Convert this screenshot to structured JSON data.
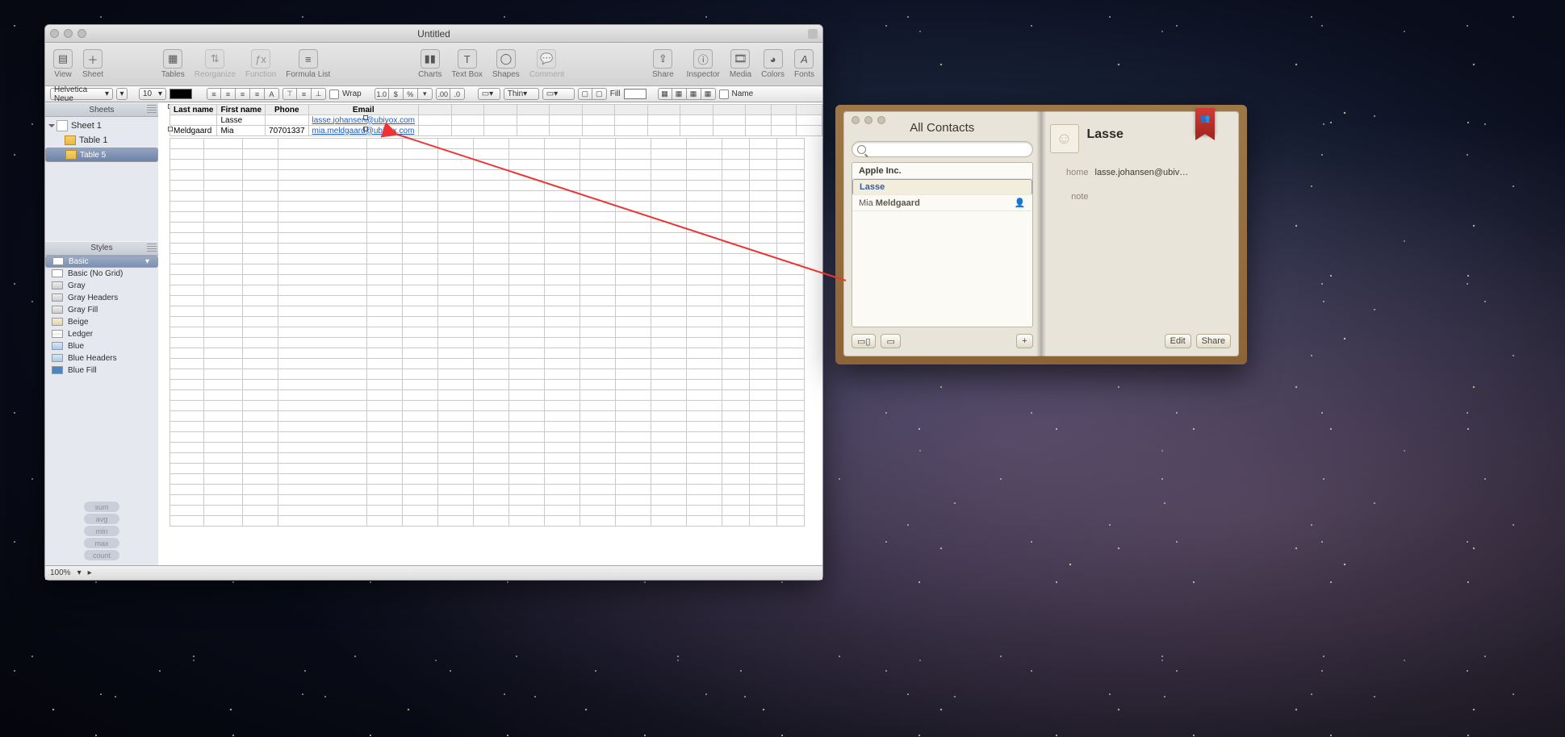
{
  "numbers": {
    "window_title": "Untitled",
    "toolbar": {
      "view": "View",
      "sheet": "Sheet",
      "tables": "Tables",
      "reorganize": "Reorganize",
      "function": "Function",
      "formula_list": "Formula List",
      "charts": "Charts",
      "text_box": "Text Box",
      "shapes": "Shapes",
      "comment": "Comment",
      "share": "Share",
      "inspector": "Inspector",
      "media": "Media",
      "colors": "Colors",
      "fonts": "Fonts"
    },
    "format": {
      "font_family": "Helvetica Neue",
      "font_size": "10",
      "wrap": "Wrap",
      "number_fmt": "1.0",
      "stroke_style": "Thin",
      "fill_label": "Fill",
      "name_label": "Name"
    },
    "sidebar": {
      "sheets_label": "Sheets",
      "sheet_name": "Sheet 1",
      "tables": [
        "Table 1",
        "Table 5"
      ],
      "selected_table_index": 1,
      "styles_label": "Styles",
      "styles": [
        "Basic",
        "Basic (No Grid)",
        "Gray",
        "Gray Headers",
        "Gray Fill",
        "Beige",
        "Ledger",
        "Blue",
        "Blue Headers",
        "Blue Fill"
      ],
      "selected_style_index": 0,
      "stats": [
        "sum",
        "avg",
        "min",
        "max",
        "count"
      ]
    },
    "table": {
      "headers": [
        "Last name",
        "First name",
        "Phone",
        "Email"
      ],
      "rows": [
        {
          "last_name": "",
          "first_name": "Lasse",
          "phone": "",
          "email": "lasse.johansen@ubivox.com"
        },
        {
          "last_name": "Meldgaard",
          "first_name": "Mia",
          "phone": "70701337",
          "email": "mia.meldgaard@ubivox.com"
        }
      ]
    },
    "status": {
      "zoom": "100%"
    }
  },
  "contacts": {
    "title": "All Contacts",
    "search_placeholder": "",
    "list": [
      {
        "label": "Apple Inc.",
        "type": "group"
      },
      {
        "label": "Lasse",
        "type": "person",
        "selected": true
      },
      {
        "label": "Mia Meldgaard",
        "type": "person"
      }
    ],
    "buttons": {
      "edit": "Edit",
      "share": "Share",
      "add": "+"
    },
    "card": {
      "name": "Lasse",
      "fields": [
        {
          "label": "home",
          "value": "lasse.johansen@ubiv…"
        },
        {
          "label": "note",
          "value": ""
        }
      ]
    }
  }
}
